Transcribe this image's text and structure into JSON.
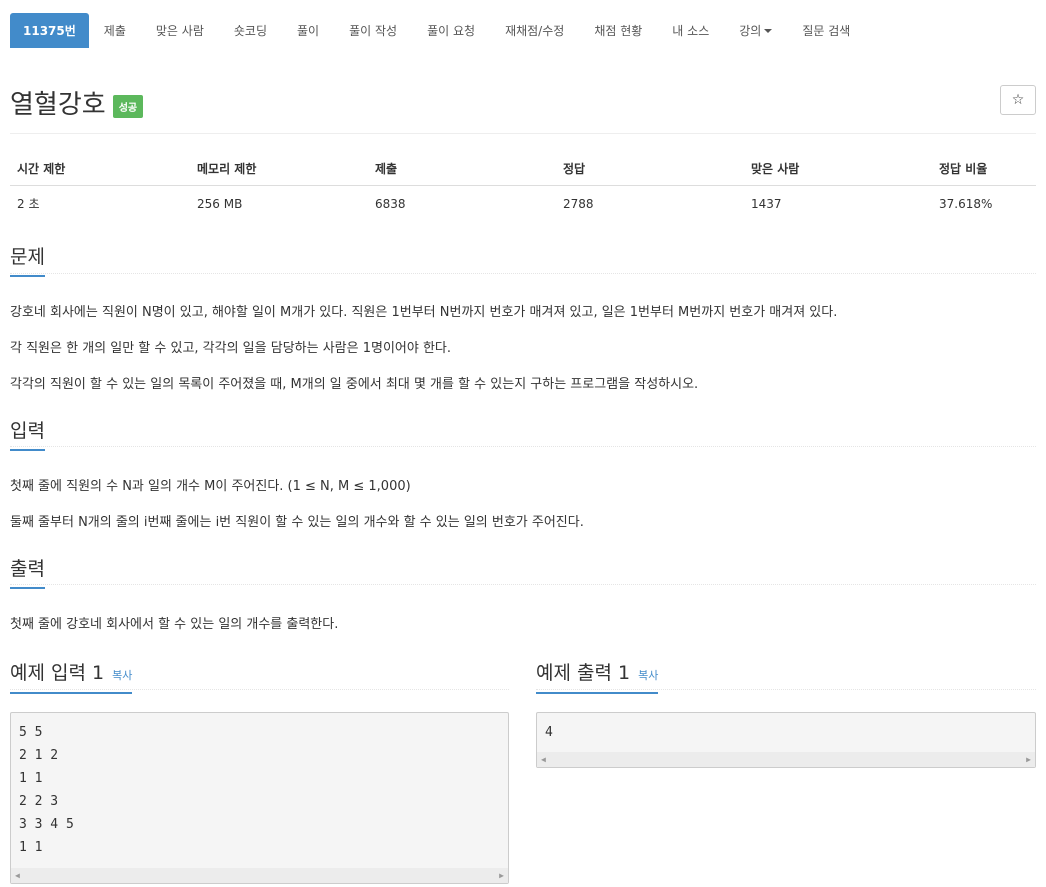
{
  "nav": {
    "items": [
      {
        "label": "11375번",
        "active": true
      },
      {
        "label": "제출"
      },
      {
        "label": "맞은 사람"
      },
      {
        "label": "숏코딩"
      },
      {
        "label": "풀이"
      },
      {
        "label": "풀이 작성"
      },
      {
        "label": "풀이 요청"
      },
      {
        "label": "재채점/수정"
      },
      {
        "label": "채점 현황"
      },
      {
        "label": "내 소스"
      },
      {
        "label": "강의",
        "dropdown": true
      },
      {
        "label": "질문 검색"
      }
    ]
  },
  "problem": {
    "title": "열혈강호",
    "badge": "성공",
    "badge_color": "#5cb85c",
    "star_icon": "star-outline-icon",
    "star_glyph": "☆"
  },
  "info": {
    "headers": [
      "시간 제한",
      "메모리 제한",
      "제출",
      "정답",
      "맞은 사람",
      "정답 비율"
    ],
    "values": [
      "2 초",
      "256 MB",
      "6838",
      "2788",
      "1437",
      "37.618%"
    ]
  },
  "sections": {
    "problem": {
      "heading": "문제",
      "paragraphs": [
        "강호네 회사에는 직원이 N명이 있고, 해야할 일이 M개가 있다. 직원은 1번부터 N번까지 번호가 매겨져 있고, 일은 1번부터 M번까지 번호가 매겨져 있다.",
        "각 직원은 한 개의 일만 할 수 있고, 각각의 일을 담당하는 사람은 1명이어야 한다.",
        "각각의 직원이 할 수 있는 일의 목록이 주어졌을 때, M개의 일 중에서 최대 몇 개를 할 수 있는지 구하는 프로그램을 작성하시오."
      ]
    },
    "input": {
      "heading": "입력",
      "paragraphs": [
        "첫째 줄에 직원의 수 N과 일의 개수 M이 주어진다. (1 ≤ N, M ≤ 1,000)",
        "둘째 줄부터 N개의 줄의 i번째 줄에는 i번 직원이 할 수 있는 일의 개수와 할 수 있는 일의 번호가 주어진다."
      ]
    },
    "output": {
      "heading": "출력",
      "paragraphs": [
        "첫째 줄에 강호네 회사에서 할 수 있는 일의 개수를 출력한다."
      ]
    }
  },
  "samples": {
    "input": {
      "heading": "예제 입력 1",
      "copy_label": "복사",
      "lines": [
        "5 5",
        "2 1 2",
        "1 1",
        "2 2 3",
        "3 3 4 5",
        "1 1"
      ]
    },
    "output": {
      "heading": "예제 출력 1",
      "copy_label": "복사",
      "lines": [
        "4"
      ]
    }
  },
  "colors": {
    "accent": "#428bca",
    "success": "#5cb85c"
  }
}
